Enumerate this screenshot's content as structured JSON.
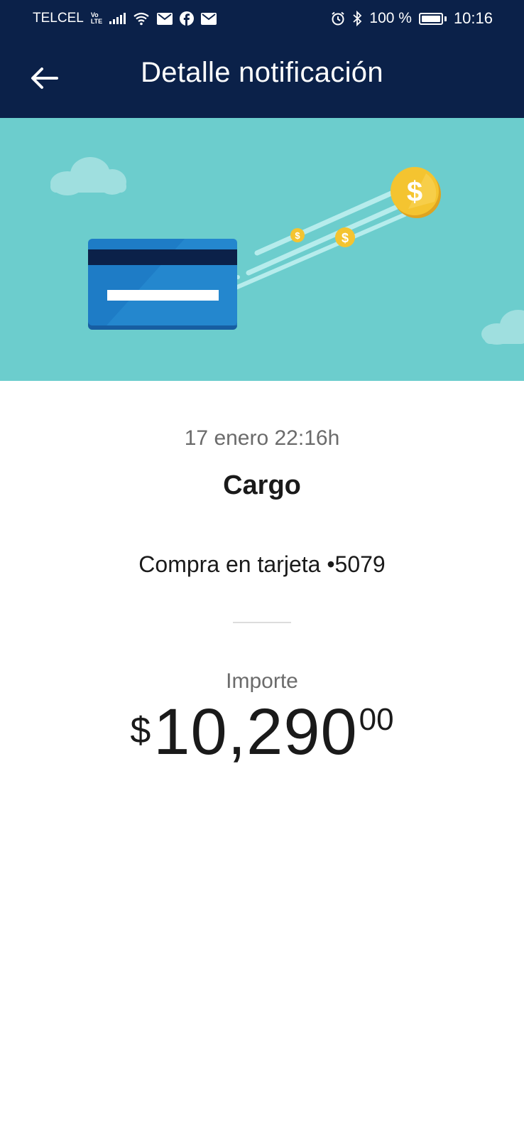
{
  "status_bar": {
    "carrier": "TELCEL",
    "volte_top": "Vo",
    "volte_bottom": "LTE",
    "battery_percent": "100 %",
    "time": "10:16",
    "icons": [
      "signal-icon",
      "wifi-icon",
      "mail-icon",
      "facebook-icon",
      "mail-icon",
      "alarm-icon",
      "bluetooth-icon",
      "battery-icon"
    ]
  },
  "app_bar": {
    "back_icon": "arrow-left-icon",
    "title": "Detalle notificación"
  },
  "hero": {
    "illustration": "credit-card-with-flying-coins",
    "coin_symbol": "$",
    "colors": {
      "background": "#6ccdcd",
      "card": "#1e7cc6",
      "coin": "#f4c430"
    }
  },
  "notification": {
    "date": "17 enero 22:16h",
    "title": "Cargo",
    "description": "Compra en tarjeta •5079",
    "amount_label": "Importe",
    "amount_currency": "$",
    "amount_integer": "10,290",
    "amount_decimals": "00"
  },
  "colors": {
    "header": "#0b2149",
    "primary_text": "#1a1a1a",
    "secondary_text": "#6b6b6b"
  }
}
